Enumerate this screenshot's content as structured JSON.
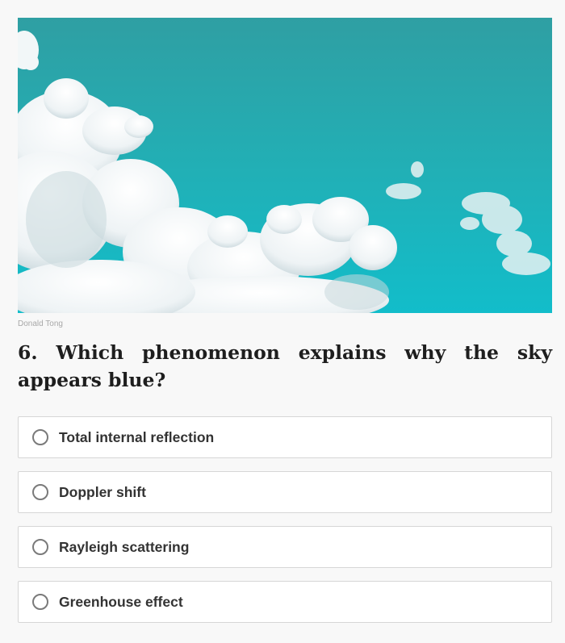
{
  "photo": {
    "credit": "Donald Tong",
    "sky_color": "#1fb3ba",
    "cloud_color": "#ffffff"
  },
  "question": {
    "text": "6. Which phenomenon explains why the sky appears blue?"
  },
  "options": [
    {
      "label": "Total internal reflection",
      "selected": false
    },
    {
      "label": "Doppler shift",
      "selected": false
    },
    {
      "label": "Rayleigh scattering",
      "selected": false
    },
    {
      "label": "Greenhouse effect",
      "selected": false
    }
  ]
}
